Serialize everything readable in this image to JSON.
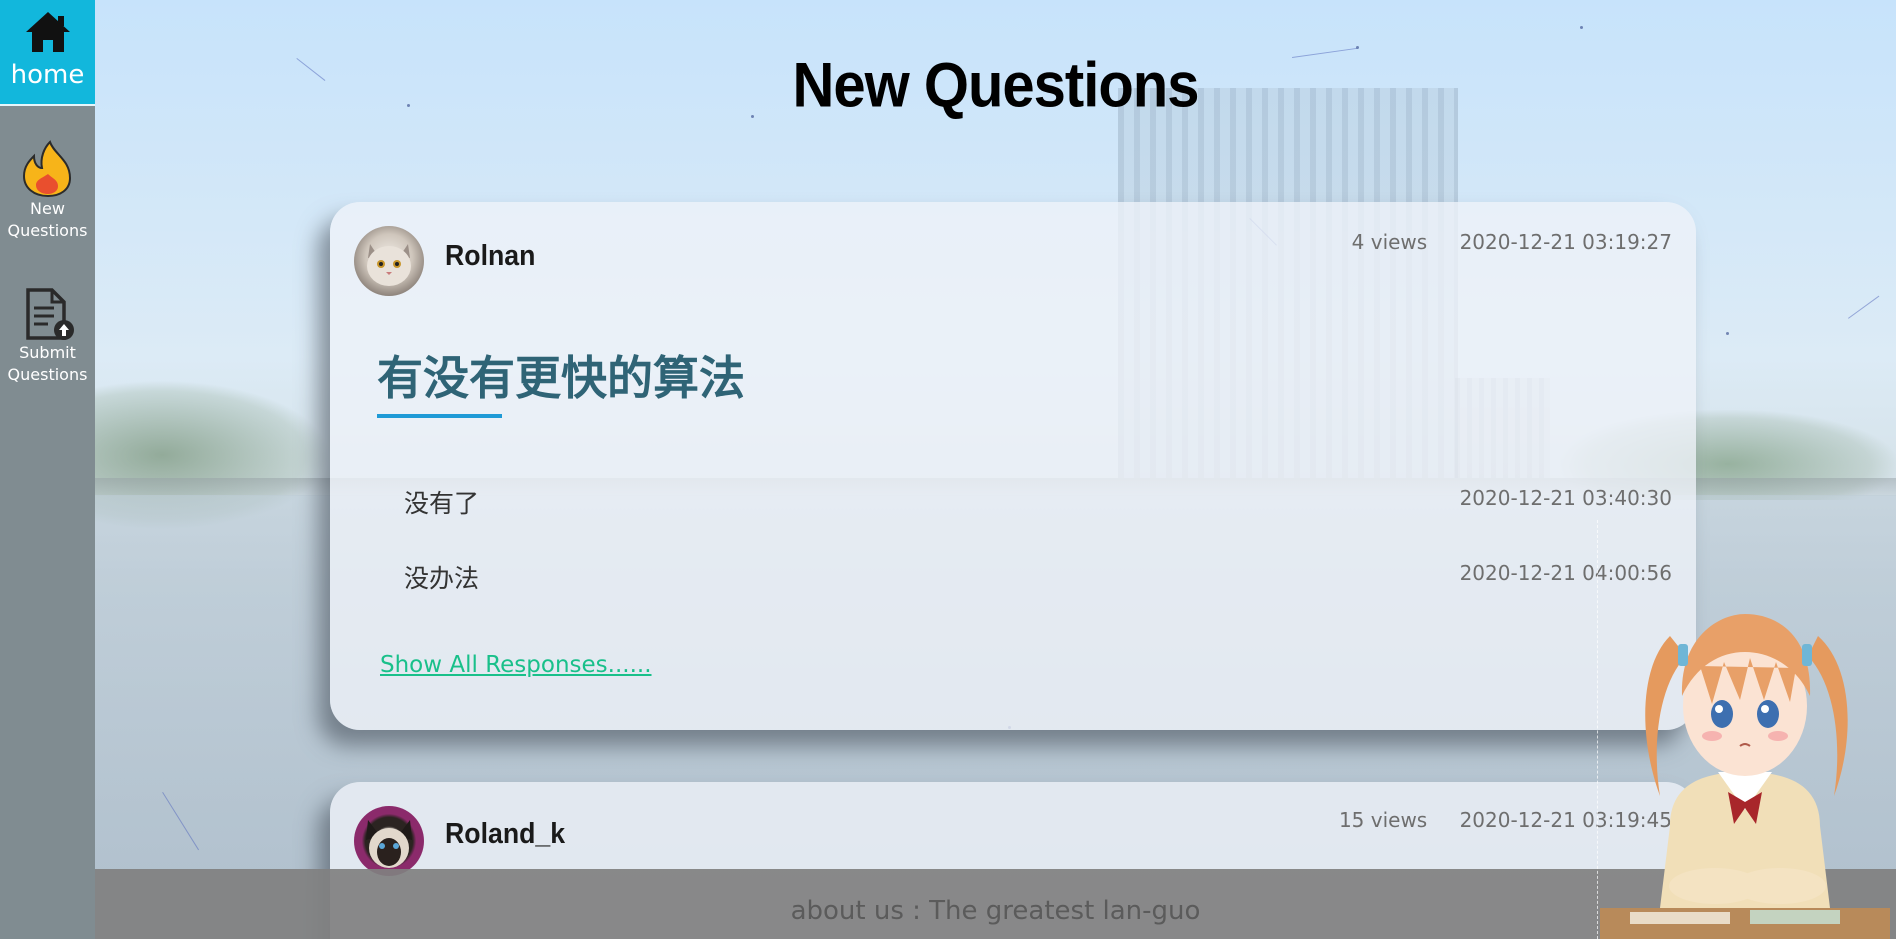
{
  "sidebar": {
    "home": {
      "label": "home",
      "icon": "home-icon"
    },
    "items": [
      {
        "label_line1": "New",
        "label_line2": "Questions",
        "icon": "fire-icon"
      },
      {
        "label_line1": "Submit",
        "label_line2": "Questions",
        "icon": "document-upload-icon"
      }
    ]
  },
  "header": {
    "title": "New Questions"
  },
  "questions": [
    {
      "user": "Rolnan",
      "views": "4 views",
      "time": "2020-12-21 03:19:27",
      "title": "有没有更快的算法",
      "responses": [
        {
          "text": "没有了",
          "time": "2020-12-21 03:40:30"
        },
        {
          "text": "没办法",
          "time": "2020-12-21 04:00:56"
        }
      ],
      "show_all_label": "Show All Responses......"
    },
    {
      "user": "Roland_k",
      "views": "15 views",
      "time": "2020-12-21 03:19:45"
    }
  ],
  "footer": {
    "text": "about us : The greatest lan-guo"
  },
  "colors": {
    "home_active": "#12b7dc",
    "sidebar": "#808c91",
    "title_text": "#2f6476",
    "underline": "#1e9ad6",
    "link": "#19c08a"
  }
}
